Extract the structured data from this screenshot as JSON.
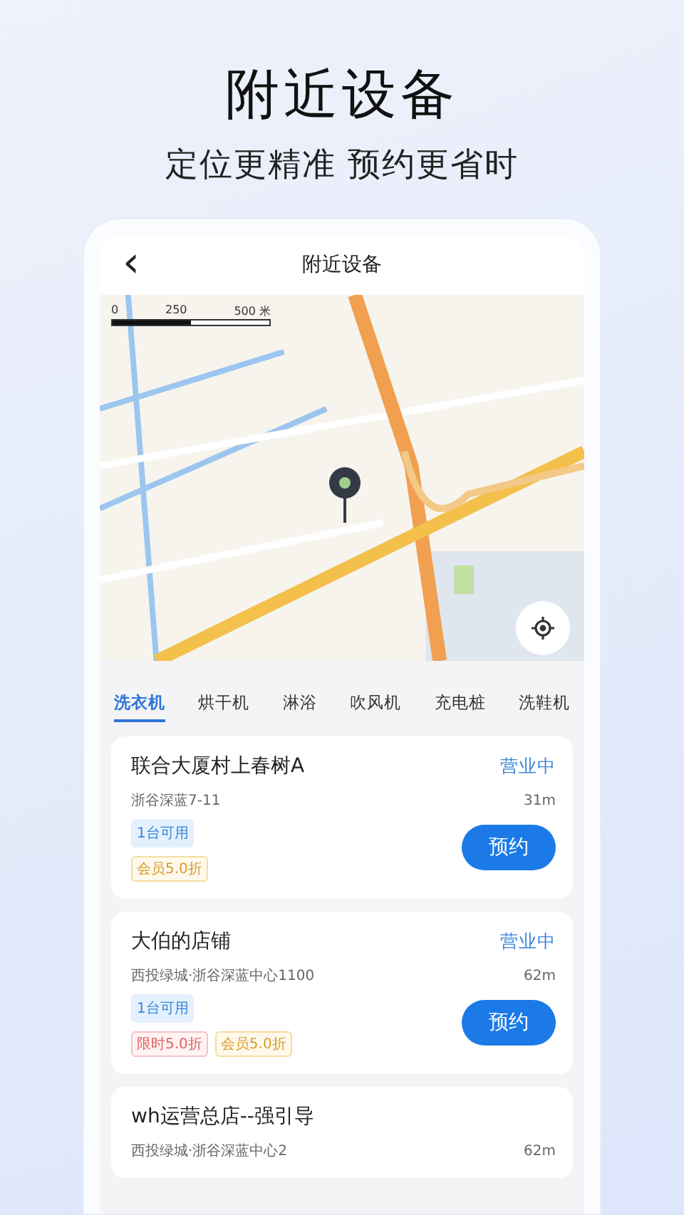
{
  "promo": {
    "title": "附近设备",
    "subtitle": "定位更精准 预约更省时"
  },
  "nav": {
    "back": "‹",
    "title": "附近设备"
  },
  "map": {
    "scale_labels": [
      "0",
      "250",
      "500 米"
    ]
  },
  "tabs": [
    {
      "label": "洗衣机",
      "selected": true
    },
    {
      "label": "烘干机",
      "selected": false
    },
    {
      "label": "淋浴",
      "selected": false
    },
    {
      "label": "吹风机",
      "selected": false
    },
    {
      "label": "充电桩",
      "selected": false
    },
    {
      "label": "洗鞋机",
      "selected": false
    }
  ],
  "stores": [
    {
      "name": "联合大厦村上春树A",
      "status": "营业中",
      "address": "浙谷深蓝7-11",
      "distance": "31m",
      "tags": [
        {
          "text": "1台可用",
          "kind": "available"
        },
        {
          "text": "会员5.0折",
          "kind": "member"
        }
      ],
      "button": "预约"
    },
    {
      "name": "大伯的店铺",
      "status": "营业中",
      "address": "西投绿城·浙谷深蓝中心1100",
      "distance": "62m",
      "tags": [
        {
          "text": "1台可用",
          "kind": "available"
        },
        {
          "text": "限时5.0折",
          "kind": "limited"
        },
        {
          "text": "会员5.0折",
          "kind": "member"
        }
      ],
      "button": "预约"
    },
    {
      "name": "wh运营总店--强引导",
      "address": "西投绿城·浙谷深蓝中心2",
      "distance": "62m"
    }
  ]
}
